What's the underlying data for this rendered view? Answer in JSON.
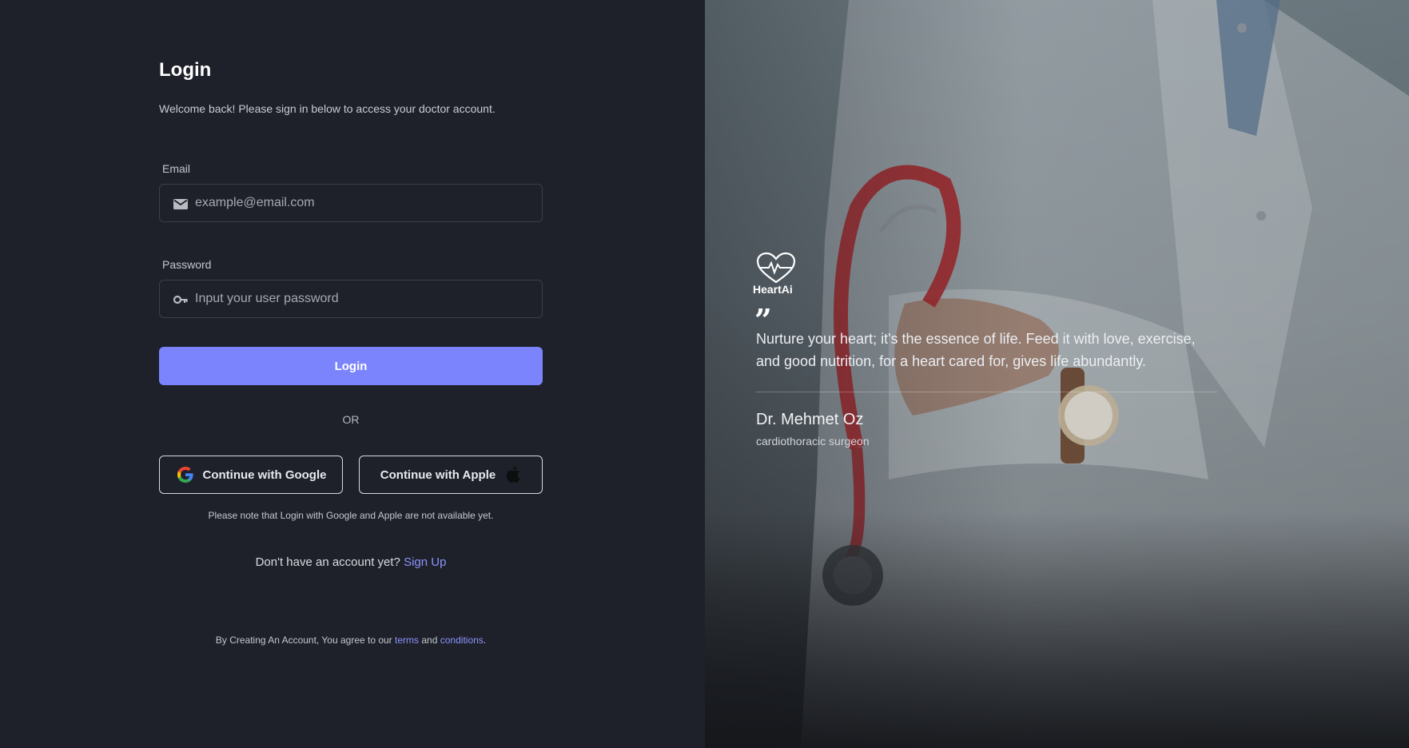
{
  "login": {
    "title": "Login",
    "subtitle": "Welcome back! Please sign in below to access your doctor account.",
    "email": {
      "label": "Email",
      "placeholder": "example@email.com",
      "icon": "mail-icon"
    },
    "password": {
      "label": "Password",
      "placeholder": "Input your user password",
      "icon": "key-icon"
    },
    "login_button": "Login",
    "or_text": "OR",
    "google_button": "Continue with Google",
    "apple_button": "Continue with Apple",
    "note": "Please note that Login with Google and Apple are not available yet.",
    "signup_prompt": "Don't have an account yet?",
    "signup_link": "Sign Up",
    "terms_prefix": "By Creating An Account, You agree to our",
    "terms_link": "terms",
    "terms_and": "and",
    "conditions_link": "conditions",
    "terms_suffix": "."
  },
  "hero": {
    "brand": "HeartAi",
    "quote": "Nurture your heart; it's the essence of life. Feed it with love, exercise, and good nutrition, for a heart cared for, gives life abundantly.",
    "author": "Dr. Mehmet Oz",
    "role": "cardiothoracic surgeon"
  },
  "colors": {
    "background": "#1e2129",
    "accent": "#7b84fc",
    "link": "#8d94ff"
  }
}
